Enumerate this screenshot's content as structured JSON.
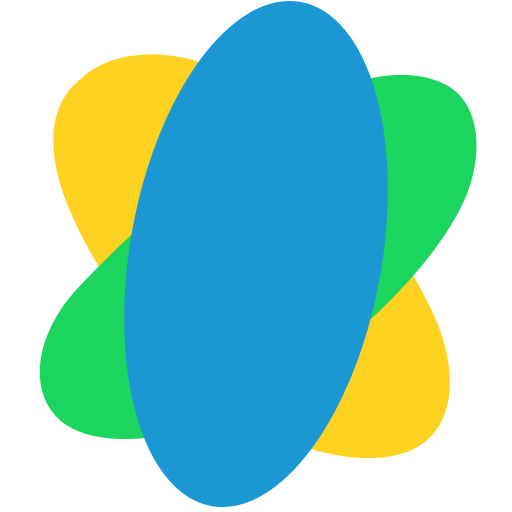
{
  "logo": {
    "icon_name": "overlapping-petals-logo",
    "colors": {
      "background": "#ffffff",
      "yellow_petal": "#fdd221",
      "green_petal": "#1cd55e",
      "blue_petal": "#1b98d4"
    }
  }
}
